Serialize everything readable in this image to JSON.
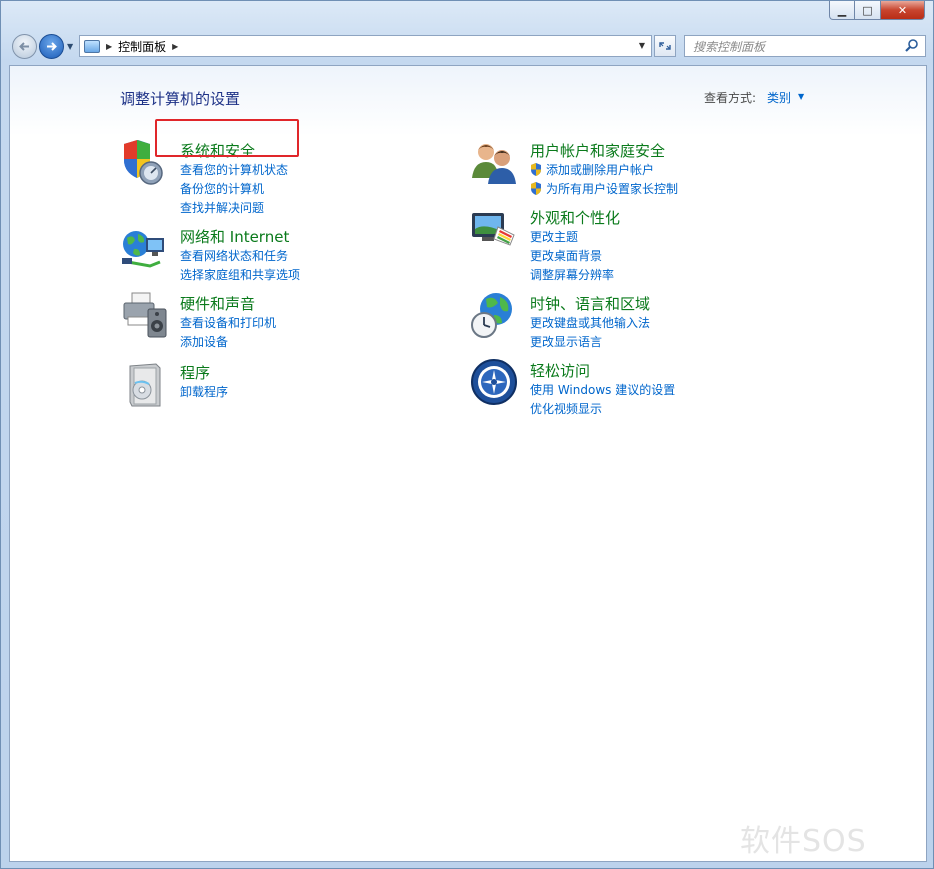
{
  "window": {
    "minimize": "▁",
    "maximize": "□",
    "close": "✕"
  },
  "address": {
    "path_item": "控制面板",
    "search_placeholder": "搜索控制面板"
  },
  "header": {
    "title": "调整计算机的设置",
    "view_label": "查看方式:",
    "view_value": "类别"
  },
  "left_categories": [
    {
      "title": "系统和安全",
      "icon": "shield-pc-icon",
      "links": [
        "查看您的计算机状态",
        "备份您的计算机",
        "查找并解决问题"
      ]
    },
    {
      "title": "网络和 Internet",
      "icon": "network-globe-icon",
      "links": [
        "查看网络状态和任务",
        "选择家庭组和共享选项"
      ]
    },
    {
      "title": "硬件和声音",
      "icon": "printer-speaker-icon",
      "links": [
        "查看设备和打印机",
        "添加设备"
      ]
    },
    {
      "title": "程序",
      "icon": "programs-box-icon",
      "links": [
        "卸载程序"
      ]
    }
  ],
  "right_categories": [
    {
      "title": "用户帐户和家庭安全",
      "icon": "users-icon",
      "links": [
        "添加或删除用户帐户",
        "为所有用户设置家长控制"
      ]
    },
    {
      "title": "外观和个性化",
      "icon": "monitor-palette-icon",
      "links": [
        "更改主题",
        "更改桌面背景",
        "调整屏幕分辨率"
      ]
    },
    {
      "title": "时钟、语言和区域",
      "icon": "globe-clock-icon",
      "links": [
        "更改键盘或其他输入法",
        "更改显示语言"
      ]
    },
    {
      "title": "轻松访问",
      "icon": "ease-of-access-icon",
      "links": [
        "使用 Windows 建议的设置",
        "优化视频显示"
      ]
    }
  ],
  "watermark": "软件SOS",
  "colors": {
    "title_green": "#0a7a1b",
    "link_blue": "#0066cc",
    "highlight_red": "#e0262a"
  }
}
